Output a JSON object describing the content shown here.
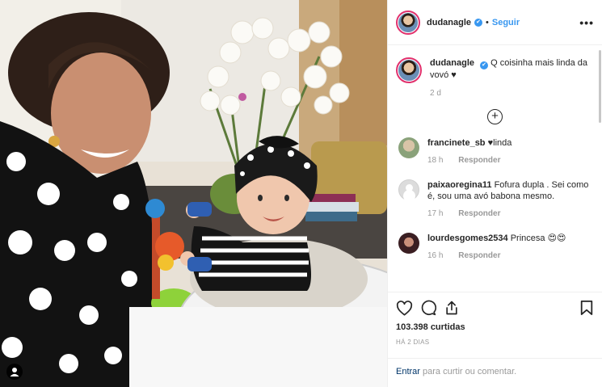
{
  "post": {
    "username": "dudanagle",
    "verified_mark": "✔",
    "separator": "•",
    "follow_label": "Seguir",
    "more_label": "•••",
    "photo_icon": "user-tag-icon"
  },
  "caption": {
    "username": "dudanagle",
    "text": "Q coisinha mais linda da vovó ♥",
    "time": "2 d"
  },
  "load_more_icon": "plus-circle-icon",
  "load_more_label": "+",
  "comments": [
    {
      "username": "francinete_sb",
      "text": "♥linda",
      "time": "18 h",
      "reply": "Responder"
    },
    {
      "username": "paixaoregina11",
      "text": "Fofura dupla . Sei como é, sou uma avó babona mesmo.",
      "time": "17 h",
      "reply": "Responder"
    },
    {
      "username": "lourdesgomes2534",
      "text": "Princesa 😍😍",
      "time": "16 h",
      "reply": "Responder"
    }
  ],
  "actions": {
    "icons": [
      "heart-icon",
      "comment-icon",
      "share-icon",
      "bookmark-icon"
    ],
    "likes": "103.398 curtidas",
    "date": "HÁ 2 DIAS"
  },
  "add_comment": {
    "login": "Entrar",
    "text": "para curtir ou comentar."
  }
}
